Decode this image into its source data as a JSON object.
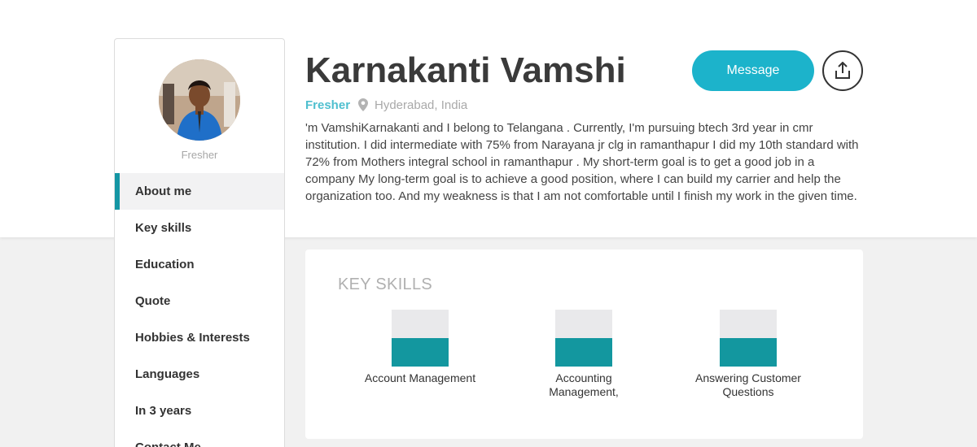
{
  "profile": {
    "name": "Karnakanti Vamshi",
    "role": "Fresher",
    "location": "Hyderabad, India",
    "bio": "'m VamshiKarnakanti and I belong to Telangana . Currently, I'm pursuing btech 3rd year in cmr institution. I did intermediate with 75% from Narayana jr clg in ramanthapur I did my 10th standard with 72% from Mothers integral school in ramanthapur . My short-term goal is to get a good job in a company My long-term goal is to achieve a good position, where I can build my carrier and help the organization too. And my weakness is that I am not comfortable until I finish my work in the given time."
  },
  "sidebar": {
    "role": "Fresher",
    "items": [
      {
        "label": "About me",
        "active": true
      },
      {
        "label": "Key skills"
      },
      {
        "label": "Education"
      },
      {
        "label": "Quote"
      },
      {
        "label": "Hobbies & Interests"
      },
      {
        "label": "Languages"
      },
      {
        "label": "In 3 years"
      },
      {
        "label": "Contact Me"
      }
    ]
  },
  "actions": {
    "message_label": "Message",
    "share_icon": "share-upload-icon"
  },
  "skills": {
    "title": "KEY SKILLS",
    "items": [
      {
        "label": "Account Management",
        "level": 0.5
      },
      {
        "label": "Accounting Management,",
        "level": 0.5
      },
      {
        "label": "Answering Customer Questions",
        "level": 0.5
      }
    ]
  },
  "colors": {
    "accent": "#1cb3cb",
    "active_bar": "#1496a4",
    "skill_fill": "#13979f",
    "role_text": "#4fbfcf"
  }
}
